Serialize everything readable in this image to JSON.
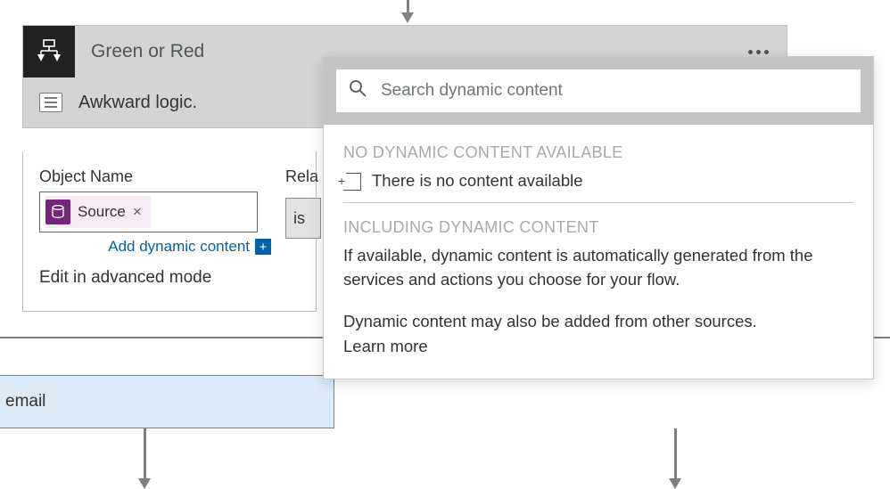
{
  "card": {
    "title": "Green or Red",
    "subtitle": "Awkward logic."
  },
  "editor": {
    "object_label": "Object Name",
    "token_label": "Source",
    "add_dc": "Add dynamic content",
    "advanced_link": "Edit in advanced mode",
    "relation_label": "Rela",
    "relation_value": "is"
  },
  "popup": {
    "search_placeholder": "Search dynamic content",
    "no_hdr": "NO DYNAMIC CONTENT AVAILABLE",
    "no_text": "There is no content available",
    "inc_hdr": "INCLUDING DYNAMIC CONTENT",
    "para1": "If available, dynamic content is automatically generated from the services and actions you choose for your flow.",
    "para2": "Dynamic content may also be added from other sources.",
    "learn": "Learn more"
  },
  "side": {
    "email": "email"
  }
}
